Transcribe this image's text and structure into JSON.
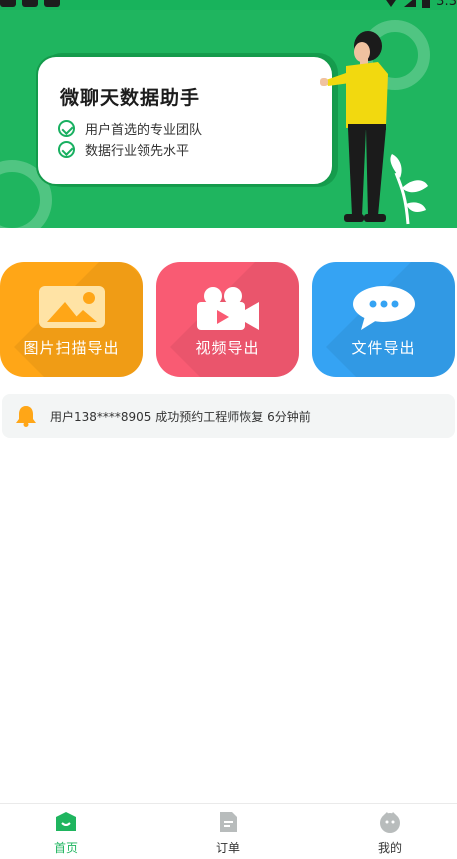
{
  "status_bar": {
    "time": "3:3"
  },
  "banner": {
    "title": "微聊天数据助手",
    "features": [
      "用户首选的专业团队",
      "数据行业领先水平"
    ]
  },
  "tiles": [
    {
      "label": "图片扫描导出",
      "icon": "image-icon",
      "color": "#ffa617"
    },
    {
      "label": "视频导出",
      "icon": "video-camera-icon",
      "color": "#f95b73"
    },
    {
      "label": "文件导出",
      "icon": "chat-bubble-icon",
      "color": "#35a3f3"
    }
  ],
  "notice": {
    "icon": "bell-icon",
    "text": "用户138****8905 成功预约工程师恢复  6分钟前"
  },
  "nav": [
    {
      "label": "首页",
      "icon": "home-icon",
      "active": true
    },
    {
      "label": "订单",
      "icon": "order-icon",
      "active": false
    },
    {
      "label": "我的",
      "icon": "profile-icon",
      "active": false
    }
  ],
  "colors": {
    "brand": "#1fb55f",
    "notice_bg": "#f3f5f5"
  }
}
